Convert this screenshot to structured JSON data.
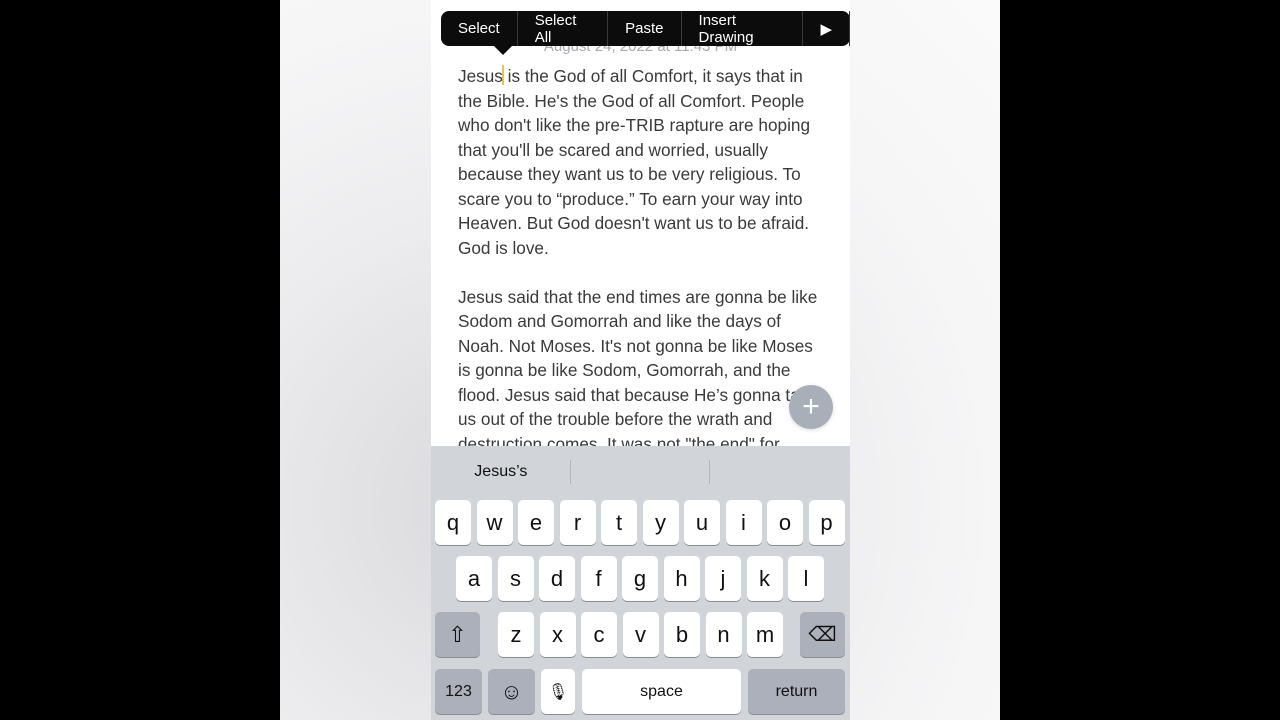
{
  "note": {
    "date": "August 24, 2022 at 11:43 PM",
    "paragraphs": [
      {
        "cursor_word": "Jesus",
        "rest": " is the God of all Comfort, it says that in the Bible. He's the God of all Comfort. People who don't like the pre-TRIB rapture are hoping that you'll be scared and worried, usually because they want us to be very religious. To scare you to “produce.” To earn your way into Heaven. But God doesn't want us to be afraid. God is love."
      },
      {
        "text": "Jesus said that the end times are gonna be like Sodom and Gomorrah and like the days of Noah. Not Moses. It's not gonna be like Moses is gonna be like Sodom, Gomorrah, and the flood. Jesus said that because He’s gonna take us out of the trouble before the wrath and destruction comes. It was not \"the end\" for"
      }
    ]
  },
  "edit_menu": {
    "items": [
      "Select",
      "Select All",
      "Paste",
      "Insert Drawing"
    ],
    "more_icon": "▶"
  },
  "fab": {
    "icon": "+"
  },
  "keyboard": {
    "suggestions": [
      "Jesus’s",
      "",
      ""
    ],
    "row1": [
      "q",
      "w",
      "e",
      "r",
      "t",
      "y",
      "u",
      "i",
      "o",
      "p"
    ],
    "row2": [
      "a",
      "s",
      "d",
      "f",
      "g",
      "h",
      "j",
      "k",
      "l"
    ],
    "row3": [
      "z",
      "x",
      "c",
      "v",
      "b",
      "n",
      "m"
    ],
    "shift_icon": "⇧",
    "delete_icon": "⌫",
    "numbers_label": "123",
    "emoji_icon": "☺",
    "mic_icon": "🎙",
    "space_label": "space",
    "return_label": "return"
  }
}
